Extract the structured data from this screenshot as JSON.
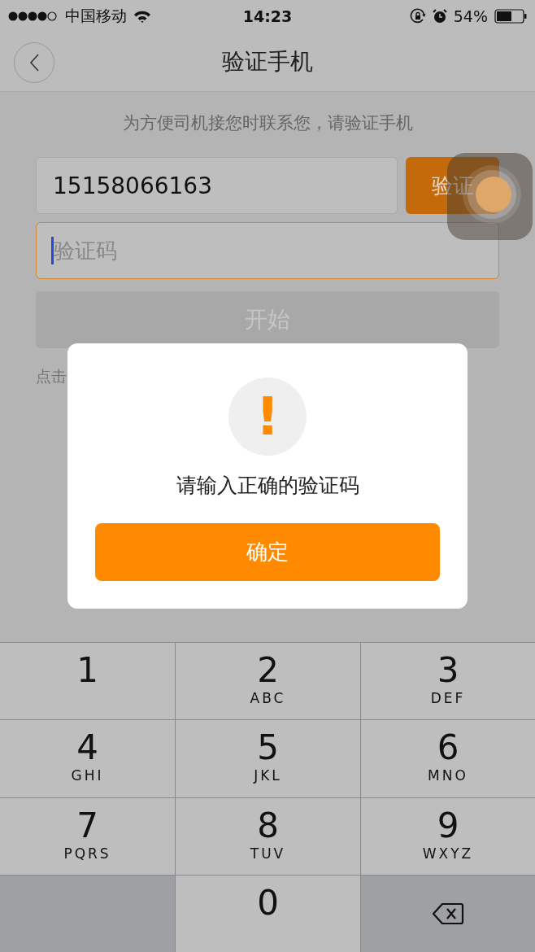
{
  "status_bar": {
    "carrier": "中国移动",
    "time": "14:23",
    "battery": "54%"
  },
  "nav": {
    "title": "验证手机"
  },
  "hint": "为方便司机接您时联系您，请验证手机",
  "phone_field": {
    "value": "15158066163"
  },
  "verify_button": "验证",
  "code_field": {
    "placeholder": "验证码",
    "focused": true
  },
  "start_button": {
    "label": "开始",
    "disabled": true
  },
  "note": "点击",
  "dialog": {
    "icon": "!",
    "message": "请输入正确的验证码",
    "button": "确定"
  },
  "keypad": [
    {
      "kind": "digit",
      "digit": "1"
    },
    {
      "kind": "digit",
      "digit": "2",
      "letters": "ABC"
    },
    {
      "kind": "digit",
      "digit": "3",
      "letters": "DEF"
    },
    {
      "kind": "digit",
      "digit": "4",
      "letters": "GHI"
    },
    {
      "kind": "digit",
      "digit": "5",
      "letters": "JKL"
    },
    {
      "kind": "digit",
      "digit": "6",
      "letters": "MNO"
    },
    {
      "kind": "digit",
      "digit": "7",
      "letters": "PQRS"
    },
    {
      "kind": "digit",
      "digit": "8",
      "letters": "TUV"
    },
    {
      "kind": "digit",
      "digit": "9",
      "letters": "WXYZ"
    },
    {
      "kind": "blank"
    },
    {
      "kind": "digit",
      "digit": "0"
    },
    {
      "kind": "delete"
    }
  ]
}
